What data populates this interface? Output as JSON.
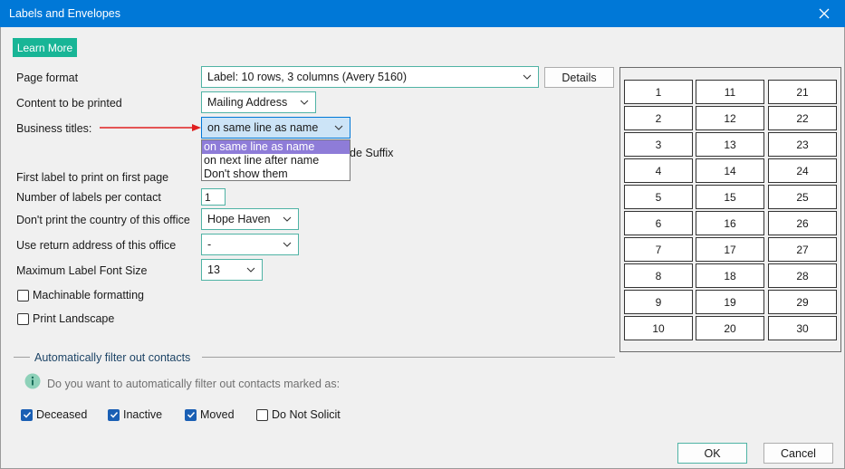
{
  "window": {
    "title": "Labels and Envelopes",
    "close_glyph": "×"
  },
  "learn_more_label": "Learn More",
  "labels": {
    "page_format": "Page format",
    "content": "Content to be printed",
    "business_titles": "Business titles:",
    "first_label": "First label to print on first page",
    "labels_per_contact": "Number of labels per contact",
    "dont_print_country": "Don't print the country of this office",
    "return_address": "Use return address of this office",
    "max_font": "Maximum Label Font Size"
  },
  "fields": {
    "page_format": "Label: 10 rows, 3 columns (Avery 5160)",
    "content": "Mailing Address",
    "business_titles": "on same line as name",
    "labels_per_contact": "1",
    "dont_print_country": "Hope Haven",
    "return_address": "-",
    "max_font": "13"
  },
  "details_label": "Details",
  "business_titles_options": [
    "on same line as name",
    "on next line after name",
    "Don't show them"
  ],
  "partially_hidden_text": "de Suffix",
  "checkboxes": {
    "machinable": {
      "label": "Machinable formatting",
      "checked": false
    },
    "landscape": {
      "label": "Print Landscape",
      "checked": false
    }
  },
  "filter": {
    "title": "Automatically filter out contacts",
    "question": "Do you want to automatically filter out contacts marked as:",
    "options": [
      {
        "label": "Deceased",
        "checked": true
      },
      {
        "label": "Inactive",
        "checked": true
      },
      {
        "label": "Moved",
        "checked": true
      },
      {
        "label": "Do Not Solicit",
        "checked": false
      }
    ]
  },
  "label_grid": [
    [
      "1",
      "11",
      "21"
    ],
    [
      "2",
      "12",
      "22"
    ],
    [
      "3",
      "13",
      "23"
    ],
    [
      "4",
      "14",
      "24"
    ],
    [
      "5",
      "15",
      "25"
    ],
    [
      "6",
      "16",
      "26"
    ],
    [
      "7",
      "17",
      "27"
    ],
    [
      "8",
      "18",
      "28"
    ],
    [
      "9",
      "19",
      "29"
    ],
    [
      "10",
      "20",
      "30"
    ]
  ],
  "buttons": {
    "ok": "OK",
    "cancel": "Cancel"
  },
  "colors": {
    "titlebar": "#0078d7",
    "accent": "#18b596",
    "arrow": "#e02020",
    "dropdown_highlight": "#8e7cd8",
    "checkbox_on": "#1a5fb4"
  }
}
